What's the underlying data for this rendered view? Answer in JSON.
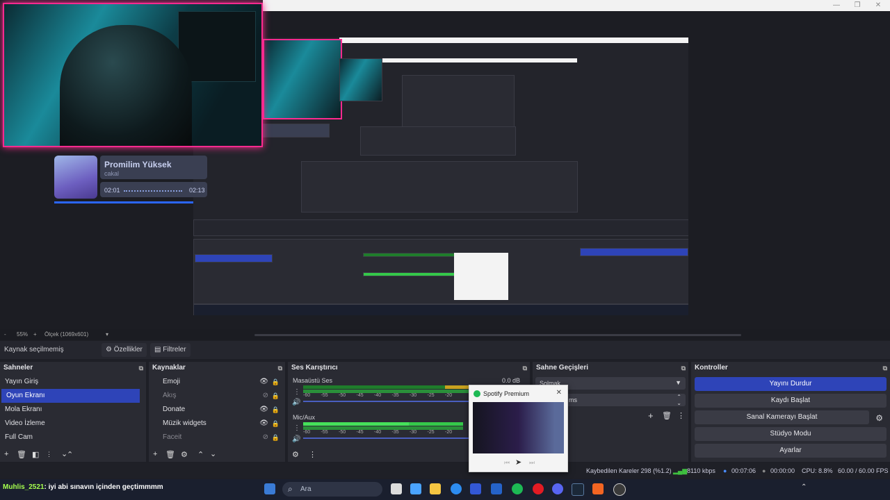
{
  "window": {
    "min": "—",
    "max": "❐",
    "close": "✕"
  },
  "stream_overlay": {
    "song_title": "Promilim Yüksek",
    "artist": "cakal",
    "time_current": "02:01",
    "time_total": "02:13",
    "progress": 0.91
  },
  "zoom_bar": {
    "minus": "-",
    "zoom": "55%",
    "plus": "+",
    "scale": "Ölçek (1069x601)"
  },
  "source_toolbar": {
    "no_source": "Kaynak seçilmemiş",
    "properties": "Özellikler",
    "filters": "Filtreler"
  },
  "scenes": {
    "title": "Sahneler",
    "items": [
      {
        "label": "Yayın Giriş",
        "selected": false
      },
      {
        "label": "Oyun Ekranı",
        "selected": true
      },
      {
        "label": "Mola Ekranı",
        "selected": false
      },
      {
        "label": "Video İzleme",
        "selected": false
      },
      {
        "label": "Full Cam",
        "selected": false
      }
    ]
  },
  "sources": {
    "title": "Kaynaklar",
    "items": [
      {
        "label": "Emoji",
        "visible": true
      },
      {
        "label": "Akış",
        "visible": false
      },
      {
        "label": "Donate",
        "visible": true
      },
      {
        "label": "Müzik widgets",
        "visible": true
      },
      {
        "label": "Faceit",
        "visible": false
      }
    ]
  },
  "mixer": {
    "title": "Ses Karıştırıcı",
    "channels": [
      {
        "name": "Masaüstü Ses",
        "db": "0.0 dB",
        "level": 0.92
      },
      {
        "name": "Mic/Aux",
        "db": "",
        "level": 0.71
      }
    ],
    "scale": [
      "-60",
      "-55",
      "-50",
      "-45",
      "-40",
      "-35",
      "-30",
      "-25",
      "-20"
    ]
  },
  "transitions": {
    "title": "Sahne Geçişleri",
    "type": "Solmak",
    "duration": "ms"
  },
  "controls": {
    "title": "Kontroller",
    "buttons": [
      "Yayını Durdur",
      "Kaydı Başlat",
      "Sanal Kamerayı Başlat",
      "Stüdyo Modu",
      "Ayarlar"
    ]
  },
  "status": {
    "dropped": "Kaybedilen Kareler 298 (%1.2)",
    "bitrate": "8110 kbps",
    "stream_time": "00:07:06",
    "rec_time": "00:00:00",
    "cpu": "CPU: 8.8%",
    "fps": "60.00 / 60.00 FPS"
  },
  "spotify_popup": {
    "title": "Spotify Premium"
  },
  "taskbar": {
    "chat_user": "Muhlis_2521",
    "chat_text": ": iyi abi sınavın içinden geçtimmmm",
    "search_placeholder": "Ara"
  },
  "colors": {
    "accent": "#2e44b8",
    "webcam_border": "#ff2a8f",
    "meter_green": "#1f7d2b"
  }
}
